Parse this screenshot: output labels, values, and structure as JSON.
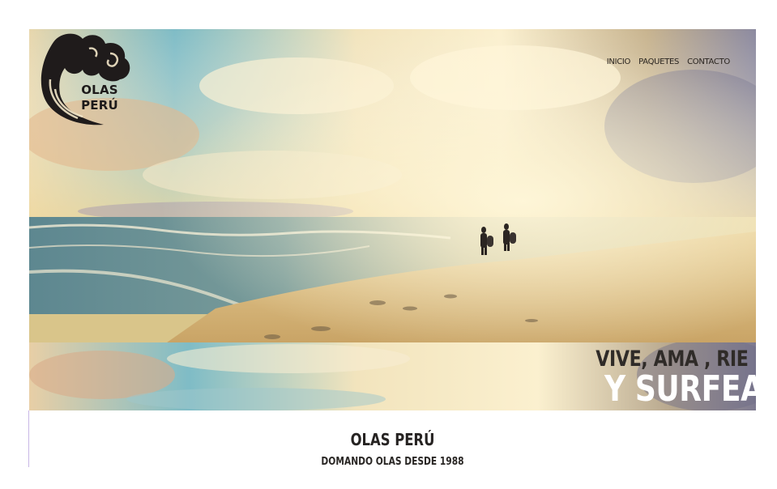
{
  "brand": {
    "logo_line1": "OLAS",
    "logo_line2": "PERÚ",
    "logo_icon": "wave-icon"
  },
  "nav": {
    "items": [
      {
        "label": "INICIO"
      },
      {
        "label": "PAQUETES"
      },
      {
        "label": "CONTACTO"
      }
    ]
  },
  "hero": {
    "tagline_top": "VIVE, AMA , RIE",
    "tagline_bottom": "Y SURFEA"
  },
  "footer": {
    "title": "OLAS PERÚ",
    "subtitle": "DOMANDO OLAS DESDE 1988"
  },
  "colors": {
    "sky_blue": "#6fb6c4",
    "sand": "#d9b775",
    "cloud": "#f5e8c4",
    "text_dark": "#262322",
    "tagline_white": "#ffffff"
  }
}
